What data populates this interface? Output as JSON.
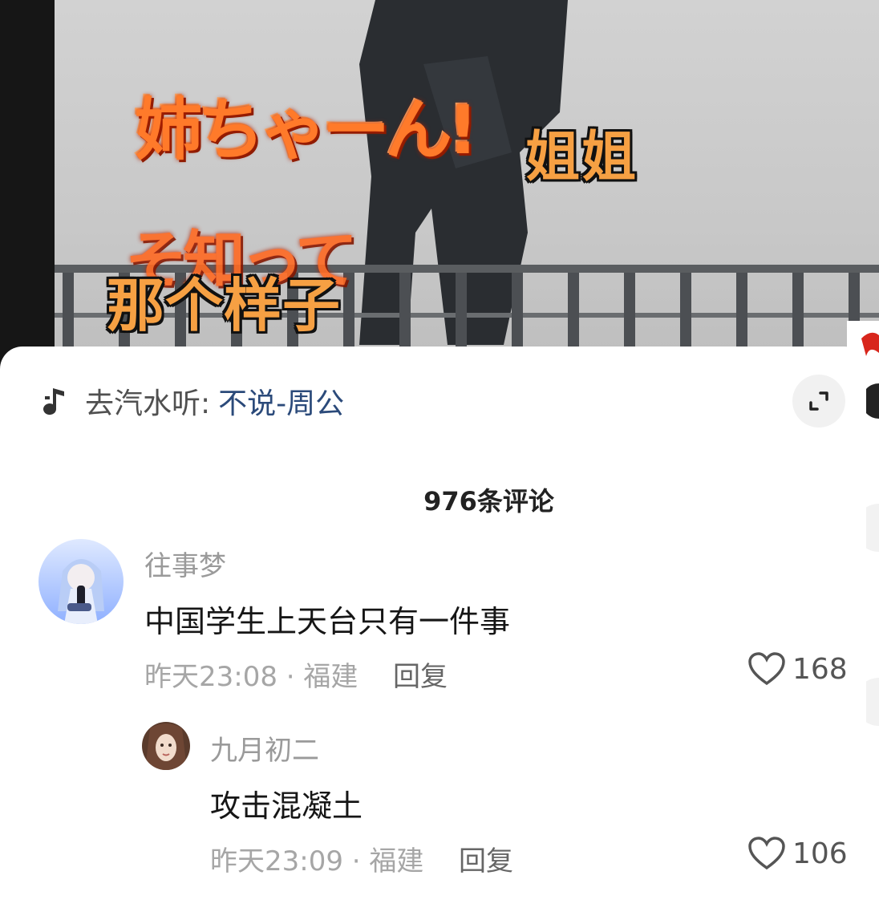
{
  "video": {
    "caption_jp_line1": "姉ちゃーん!",
    "caption_jp_line2": "そ知って",
    "caption_sister": "姐姐",
    "caption_that_look": "那个样子"
  },
  "sheet": {
    "music": {
      "prefix": "去汽水听:",
      "title": "不说-周公",
      "icon": "music-note-icon"
    },
    "expand_icon": "expand-icon",
    "comment_count": "976条评论",
    "comments": [
      {
        "user": "往事梦",
        "text": "中国学生上天台只有一件事",
        "time_location": "昨天23:08 · 福建",
        "reply_label": "回复",
        "likes": "168"
      },
      {
        "user": "九月初二",
        "text": "攻击混凝土",
        "time_location": "昨天23:09 · 福建",
        "reply_label": "回复",
        "likes": "106"
      }
    ]
  },
  "colors": {
    "sheet_bg": "#ffffff",
    "music_title": "#2b4a7a",
    "caption_orange": "#f6a043"
  }
}
